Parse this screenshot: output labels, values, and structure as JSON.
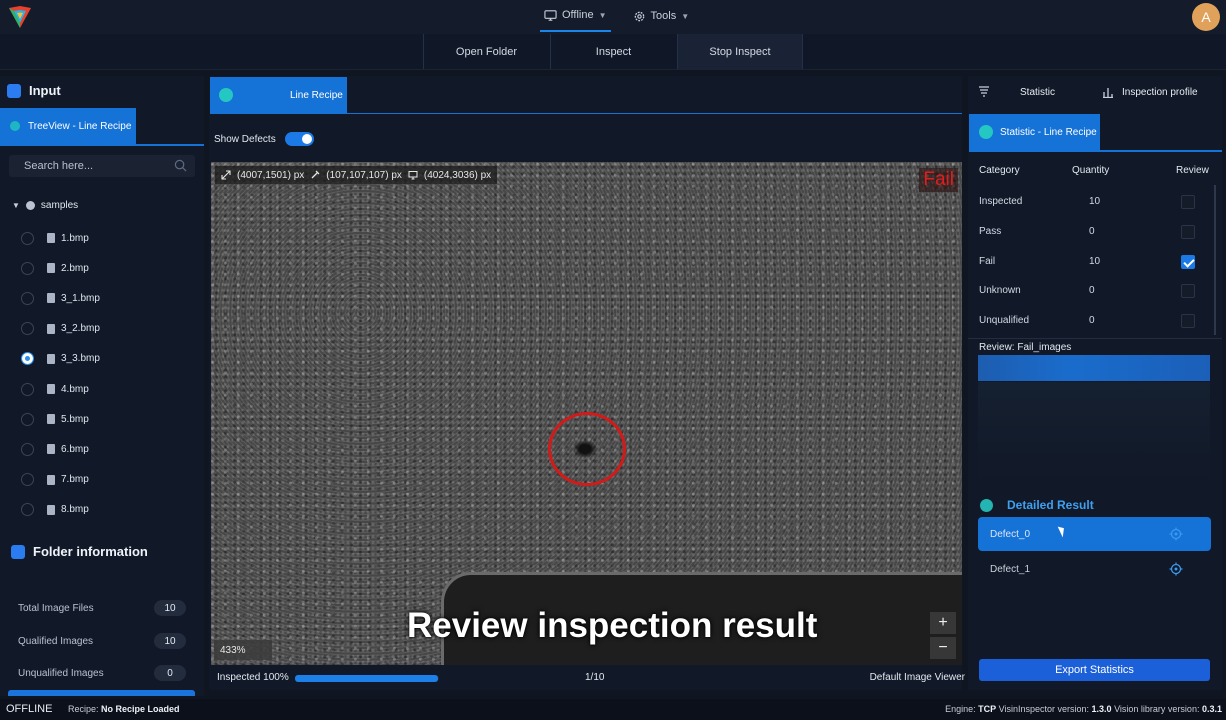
{
  "topbar": {
    "mode_label": "Offline",
    "tools_label": "Tools",
    "user_initial": "A"
  },
  "toolbar": {
    "buttons": [
      "Open Folder",
      "Inspect",
      "Stop Inspect"
    ]
  },
  "left_panel": {
    "title": "Input",
    "tab_label": "TreeView - Line Recipe",
    "search_placeholder": "Search here...",
    "tree_root": "samples",
    "files": [
      "1.bmp",
      "2.bmp",
      "3_1.bmp",
      "3_2.bmp",
      "3_3.bmp",
      "4.bmp",
      "5.bmp",
      "6.bmp",
      "7.bmp",
      "8.bmp"
    ],
    "selected_file": "3_3.bmp",
    "folder_info_title": "Folder information",
    "folder_info": [
      {
        "label": "Total Image Files",
        "value": "10"
      },
      {
        "label": "Qualified Images",
        "value": "10"
      },
      {
        "label": "Unqualified Images",
        "value": "0"
      }
    ]
  },
  "viewer": {
    "tab_label": "Line Recipe",
    "show_defects_label": "Show Defects",
    "show_defects_on": true,
    "coord_position": "(4007,1501) px",
    "coord_color": "(107,107,107) px",
    "coord_size": "(4024,3036) px",
    "result_badge": "Fail",
    "zoom": "433%",
    "zoom_in": "+",
    "zoom_out": "−",
    "caption": "Review inspection result",
    "progress_label": "Inspected 100%",
    "progress_value": 0.99,
    "page_count": "1/10",
    "viewer_mode": "Default Image Viewer"
  },
  "right_panel": {
    "tab_statistic": "Statistic",
    "tab_profile": "Inspection profile",
    "stat_tab_label": "Statistic - Line Recipe",
    "columns": [
      "Category",
      "Quantity",
      "Review"
    ],
    "rows": [
      {
        "category": "Inspected",
        "quantity": "10",
        "review": false
      },
      {
        "category": "Pass",
        "quantity": "0",
        "review": false
      },
      {
        "category": "Fail",
        "quantity": "10",
        "review": true
      },
      {
        "category": "Unknown",
        "quantity": "0",
        "review": false
      },
      {
        "category": "Unqualified",
        "quantity": "0",
        "review": false
      }
    ],
    "review_label": "Review: Fail_images",
    "detailed_title": "Detailed Result",
    "defects": [
      "Defect_0",
      "Defect_1"
    ],
    "export_label": "Export Statistics"
  },
  "statusbar": {
    "state": "OFFLINE",
    "recipe_label": "Recipe:",
    "recipe_value": "No Recipe Loaded",
    "engine_label": "Engine:",
    "engine_value": "TCP",
    "inspector_label": "VisinInspector version:",
    "inspector_value": "1.3.0",
    "library_label": "Vision library version:",
    "library_value": "0.3.1"
  },
  "colors": {
    "accent": "#1572d6",
    "fail": "#e11d1d",
    "background": "#0f1521"
  }
}
